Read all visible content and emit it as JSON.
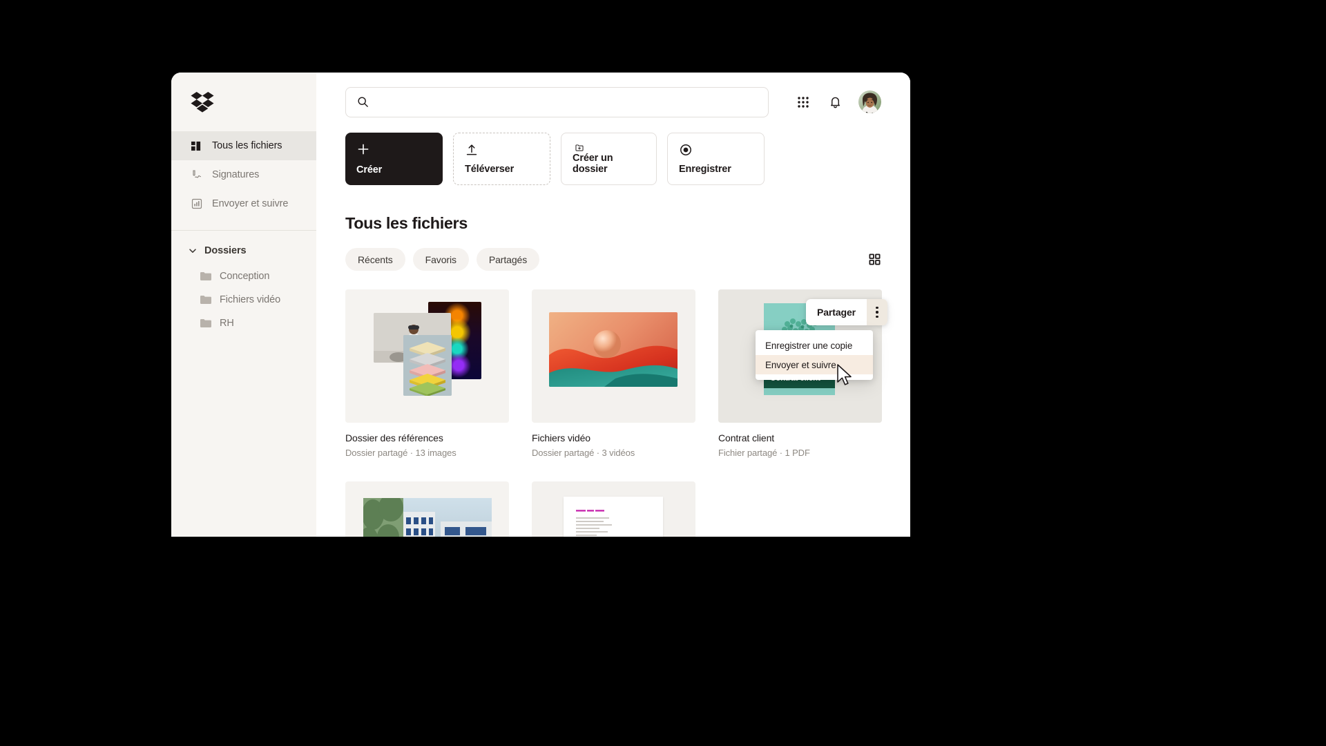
{
  "brand": {
    "logo_name": "dropbox-logo",
    "accent": "#1e1919"
  },
  "sidebar": {
    "items": [
      {
        "label": "Tous les fichiers",
        "icon": "all-files-icon",
        "active": true
      },
      {
        "label": "Signatures",
        "icon": "signature-icon",
        "active": false
      },
      {
        "label": "Envoyer et suivre",
        "icon": "send-track-icon",
        "active": false
      }
    ],
    "folders_section": {
      "label": "Dossiers",
      "expanded": true,
      "caret_icon": "chevron-down-icon"
    },
    "folders": [
      {
        "label": "Conception",
        "icon": "folder-icon"
      },
      {
        "label": "Fichiers vidéo",
        "icon": "folder-icon"
      },
      {
        "label": "RH",
        "icon": "folder-icon"
      }
    ]
  },
  "topbar": {
    "search": {
      "placeholder": "",
      "value": "",
      "icon": "search-icon"
    },
    "apps_icon": "grid-apps-icon",
    "notifications_icon": "bell-icon",
    "avatar_name": "user-avatar"
  },
  "actions": [
    {
      "label": "Créer",
      "icon": "plus-icon",
      "style": "primary"
    },
    {
      "label": "Téléverser",
      "icon": "upload-icon",
      "style": "dashed"
    },
    {
      "label": "Créer un dossier",
      "icon": "new-folder-icon",
      "style": "solid"
    },
    {
      "label": "Enregistrer",
      "icon": "record-icon",
      "style": "solid"
    }
  ],
  "main": {
    "title": "Tous les fichiers",
    "filters": [
      {
        "label": "Récents"
      },
      {
        "label": "Favoris"
      },
      {
        "label": "Partagés"
      }
    ],
    "view_toggle_icon": "grid-view-icon"
  },
  "files": [
    {
      "title": "Dossier des références",
      "meta": "Dossier partagé · 13 images",
      "thumb": "image-collage"
    },
    {
      "title": "Fichiers vidéo",
      "meta": "Dossier partagé · 3 vidéos",
      "thumb": "gradient-waves"
    },
    {
      "title": "Contrat client",
      "meta": "Fichier partagé · 1 PDF",
      "thumb": "contract-doc",
      "doc_label": "Contrat client"
    },
    {
      "title": "",
      "meta": "",
      "thumb": "building-photo"
    },
    {
      "title": "",
      "meta": "",
      "thumb": "text-document"
    }
  ],
  "share_popover": {
    "label": "Partager",
    "more_icon": "more-vertical-icon",
    "menu": [
      {
        "label": "Enregistrer une copie",
        "hover": false
      },
      {
        "label": "Envoyer et suivre",
        "hover": true
      }
    ]
  },
  "cursor": {
    "name": "mouse-pointer"
  }
}
